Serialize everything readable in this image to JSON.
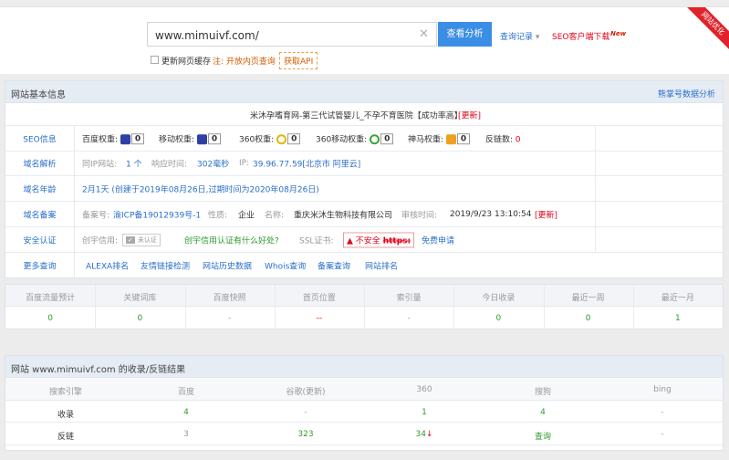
{
  "search": {
    "value": "www.mimuivf.com/",
    "button": "查看分析",
    "history": "查询记录",
    "seo_link": "SEO客户端下载",
    "new_badge": "New",
    "refresh_label": "更新网页缓存",
    "note": "注: 开放内页查询",
    "api": "获取API",
    "corner_ribbon": "网站优化"
  },
  "basic": {
    "title": "网站基本信息",
    "right_link": "熊掌号数据分析",
    "site_title": "米沐孕嗜育网-第三代试管婴儿_不孕不育医院【成功率高】",
    "site_update": "[更新]",
    "seo": {
      "label": "SEO信息",
      "baidu": "百度权重:",
      "baidu_val": "0",
      "mobile": "移动权重:",
      "mobile_val": "0",
      "s360": "360权重:",
      "s360_val": "0",
      "s360m": "360移动权重:",
      "s360m_val": "0",
      "shenma": "神马权重:",
      "shenma_val": "0",
      "backlink": "反链数:",
      "backlink_val": "0"
    },
    "dns": {
      "label": "域名解析",
      "ip_sites": "同IP网站:",
      "ip_sites_val": "1 个",
      "resp": "响应时间:",
      "resp_val": "302毫秒",
      "ip": "IP:",
      "ip_val": "39.96.77.59[北京市 阿里云]"
    },
    "age": {
      "label": "域名年龄",
      "text": "2月1天 (创建于2019年08月26日,过期时间为2020年08月26日)"
    },
    "icp": {
      "label": "域名备案",
      "no": "备案号:",
      "no_val": "渝ICP备19012939号-1",
      "nature": "性质:",
      "nature_val": "企业",
      "name": "名称:",
      "name_val": "重庆米沐生物科技有限公司",
      "time": "审核时间:",
      "time_val": "2019/9/23 13:10:54",
      "update": "[更新]"
    },
    "security": {
      "label": "安全认证",
      "credit": "创宇信用:",
      "credit_badge": "未认证",
      "credit_q": "创宇信用认证有什么好处?",
      "ssl": "SSL证书:",
      "ssl_badge": "不安全",
      "ssl_https": "https:",
      "ssl_free": "免费申请"
    },
    "more": {
      "label": "更多查询",
      "links": [
        "ALEXA排名",
        "友情链接检测",
        "网站历史数据",
        "Whois查询",
        "备案查询",
        "网站排名"
      ]
    }
  },
  "stats": {
    "headers": [
      "百度流量预计",
      "关键词库",
      "百度快照",
      "首页位置",
      "索引量",
      "今日收录",
      "最近一周",
      "最近一月"
    ],
    "values": [
      "0",
      "0",
      "-",
      "--",
      "-",
      "0",
      "0",
      "1"
    ]
  },
  "index": {
    "title": "网站 www.mimuivf.com 的收录/反链结果",
    "headers": [
      "搜索引擎",
      "百度",
      "谷歌(更新)",
      "360",
      "搜狗",
      "bing"
    ],
    "rows": [
      {
        "name": "收录",
        "vals": [
          "4",
          "-",
          "1",
          "4",
          "-"
        ]
      },
      {
        "name": "反链",
        "vals": [
          "3",
          "323",
          "34",
          "查询",
          "-"
        ]
      }
    ]
  }
}
